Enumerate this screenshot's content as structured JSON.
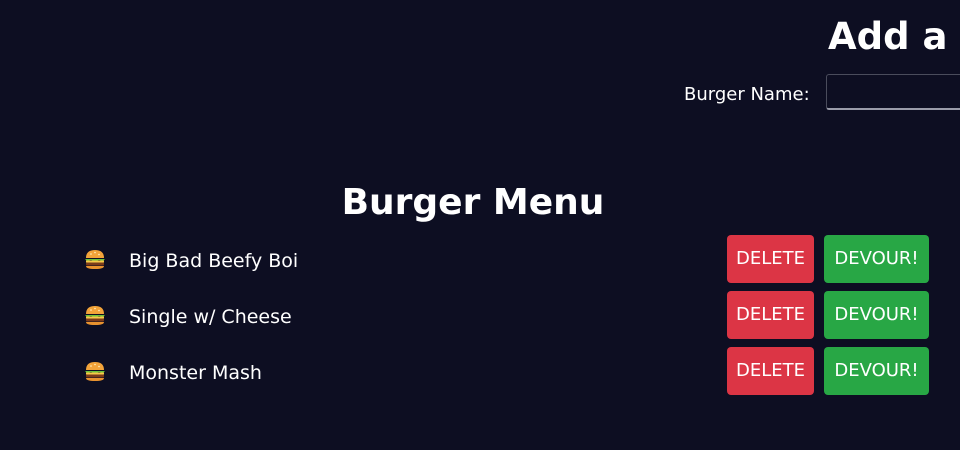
{
  "add_form": {
    "heading": "Add a Burger",
    "name_label": "Burger Name:",
    "name_value": "",
    "name_placeholder": ""
  },
  "menu": {
    "title": "Burger Menu",
    "items": [
      {
        "icon": "hamburger-icon",
        "name": "Big Bad Beefy Boi",
        "delete_label": "DELETE",
        "devour_label": "DEVOUR!"
      },
      {
        "icon": "hamburger-icon",
        "name": "Single w/ Cheese",
        "delete_label": "DELETE",
        "devour_label": "DEVOUR!"
      },
      {
        "icon": "hamburger-icon",
        "name": "Monster Mash",
        "delete_label": "DELETE",
        "devour_label": "DEVOUR!"
      }
    ]
  },
  "colors": {
    "background": "#0d0e22",
    "delete": "#dc3545",
    "devour": "#28a745"
  }
}
